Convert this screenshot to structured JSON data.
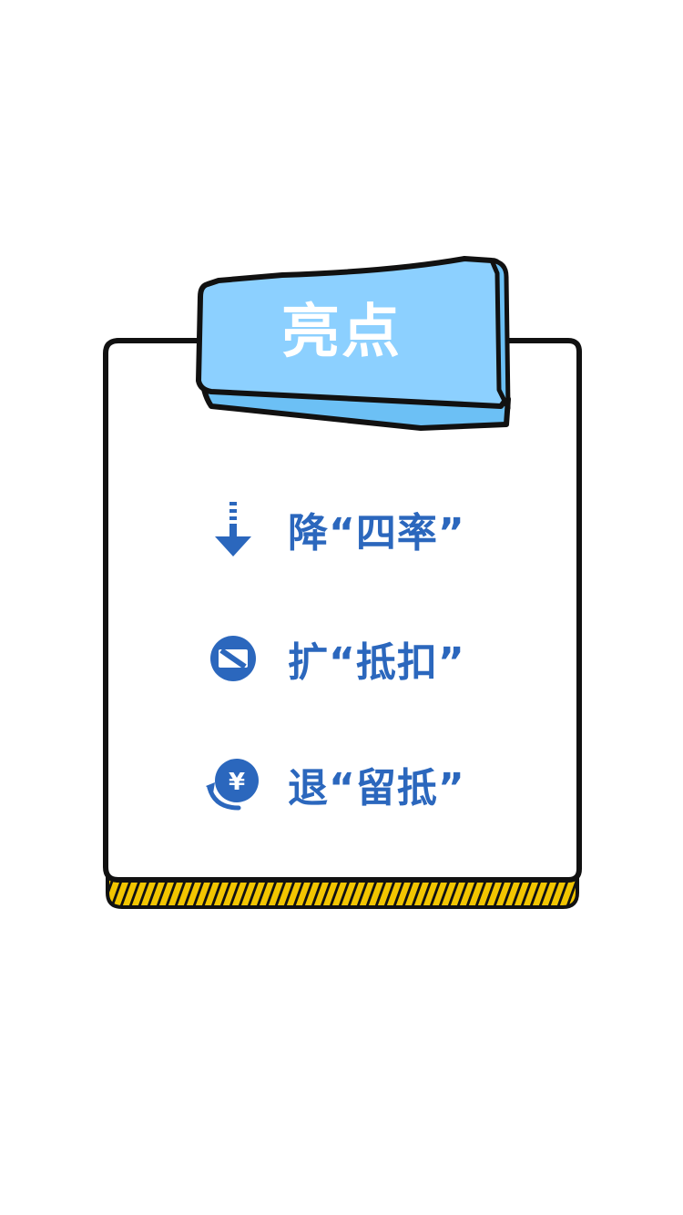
{
  "tag": {
    "title": "亮点",
    "color": "#8cd0ff"
  },
  "accent_color": "#2b67bd",
  "base_stripe_color": "#f2c500",
  "highlights": [
    {
      "icon": "down-arrow-icon",
      "text": "降“四率”"
    },
    {
      "icon": "no-entry-icon",
      "text": "扩“抵扣”"
    },
    {
      "icon": "yuan-refund-icon",
      "text": "退“留抵”"
    }
  ]
}
